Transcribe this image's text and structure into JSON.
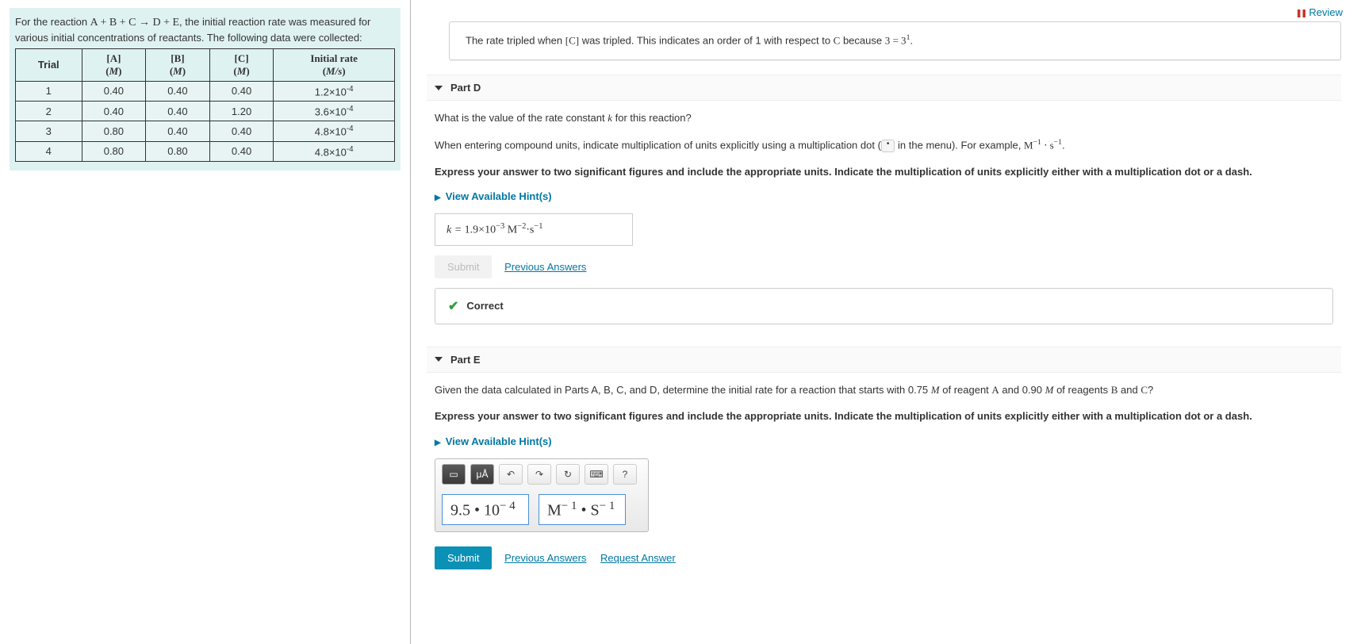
{
  "review_label": "Review",
  "intro": {
    "pre": "For the reaction ",
    "equation": "A + B + C → D + E",
    "post": ", the initial reaction rate was measured for various initial concentrations of reactants. The following data were collected:"
  },
  "table": {
    "headers": [
      "Trial",
      "[A]\n(M)",
      "[B]\n(M)",
      "[C]\n(M)",
      "Initial rate\n(M/s)"
    ],
    "rows": [
      [
        "1",
        "0.40",
        "0.40",
        "0.40",
        "1.2×10",
        "-4"
      ],
      [
        "2",
        "0.40",
        "0.40",
        "1.20",
        "3.6×10",
        "-4"
      ],
      [
        "3",
        "0.80",
        "0.40",
        "0.40",
        "4.8×10",
        "-4"
      ],
      [
        "4",
        "0.80",
        "0.80",
        "0.40",
        "4.8×10",
        "-4"
      ]
    ]
  },
  "partC_feedback": {
    "pre": "The rate tripled when ",
    "c": "[C]",
    "mid": " was tripled. This indicates an order of 1 with respect to ",
    "cvar": "C",
    "post": " because ",
    "eq": "3 = 3",
    "exp": "1",
    "end": "."
  },
  "partD": {
    "title": "Part D",
    "question": "What is the value of the rate constant k for this reaction?",
    "note_pre": "When entering compound units, indicate multiplication of units explicitly using a multiplication dot (",
    "note_post": " in the menu). For example, ",
    "example": "M",
    "ex_sup1": "−1",
    "ex_dot": " ⋅ s",
    "ex_sup2": "−1",
    "ex_end": ".",
    "instruction": "Express your answer to two significant figures and include the appropriate units. Indicate the multiplication of units explicitly either with a multiplication dot or a dash.",
    "hints": "View Available Hint(s)",
    "answer_prefix": "k = ",
    "answer_val": "1.9×10",
    "answer_sup": "−3",
    "answer_units": " M",
    "answer_usup": "−2",
    "answer_dot": "⋅s",
    "answer_usup2": "−1",
    "submit": "Submit",
    "prev": "Previous Answers",
    "correct": "Correct"
  },
  "partE": {
    "title": "Part E",
    "q_pre": "Given the data calculated in Parts A, B, C, and D, determine the initial rate for a reaction that starts with 0.75 ",
    "q_m1": "M",
    "q_mid": " of reagent ",
    "q_a": "A",
    "q_mid2": " and 0.90 ",
    "q_m2": "M",
    "q_mid3": " of reagents ",
    "q_b": "B",
    "q_and": " and ",
    "q_c": "C",
    "q_end": "?",
    "instruction": "Express your answer to two significant figures and include the appropriate units. Indicate the multiplication of units explicitly either with a multiplication dot or a dash.",
    "hints": "View Available Hint(s)",
    "toolbar": {
      "tmpl": "▭",
      "units": "μÅ",
      "undo": "↶",
      "redo": "↷",
      "reset": "↻",
      "kbd": "⌨",
      "help": "?"
    },
    "value_field": "9.5 • 10",
    "value_sup": "− 4",
    "units_field": "M",
    "units_sup1": "− 1",
    "units_dot": " • S",
    "units_sup2": "− 1",
    "submit": "Submit",
    "prev": "Previous Answers",
    "req": "Request Answer"
  }
}
